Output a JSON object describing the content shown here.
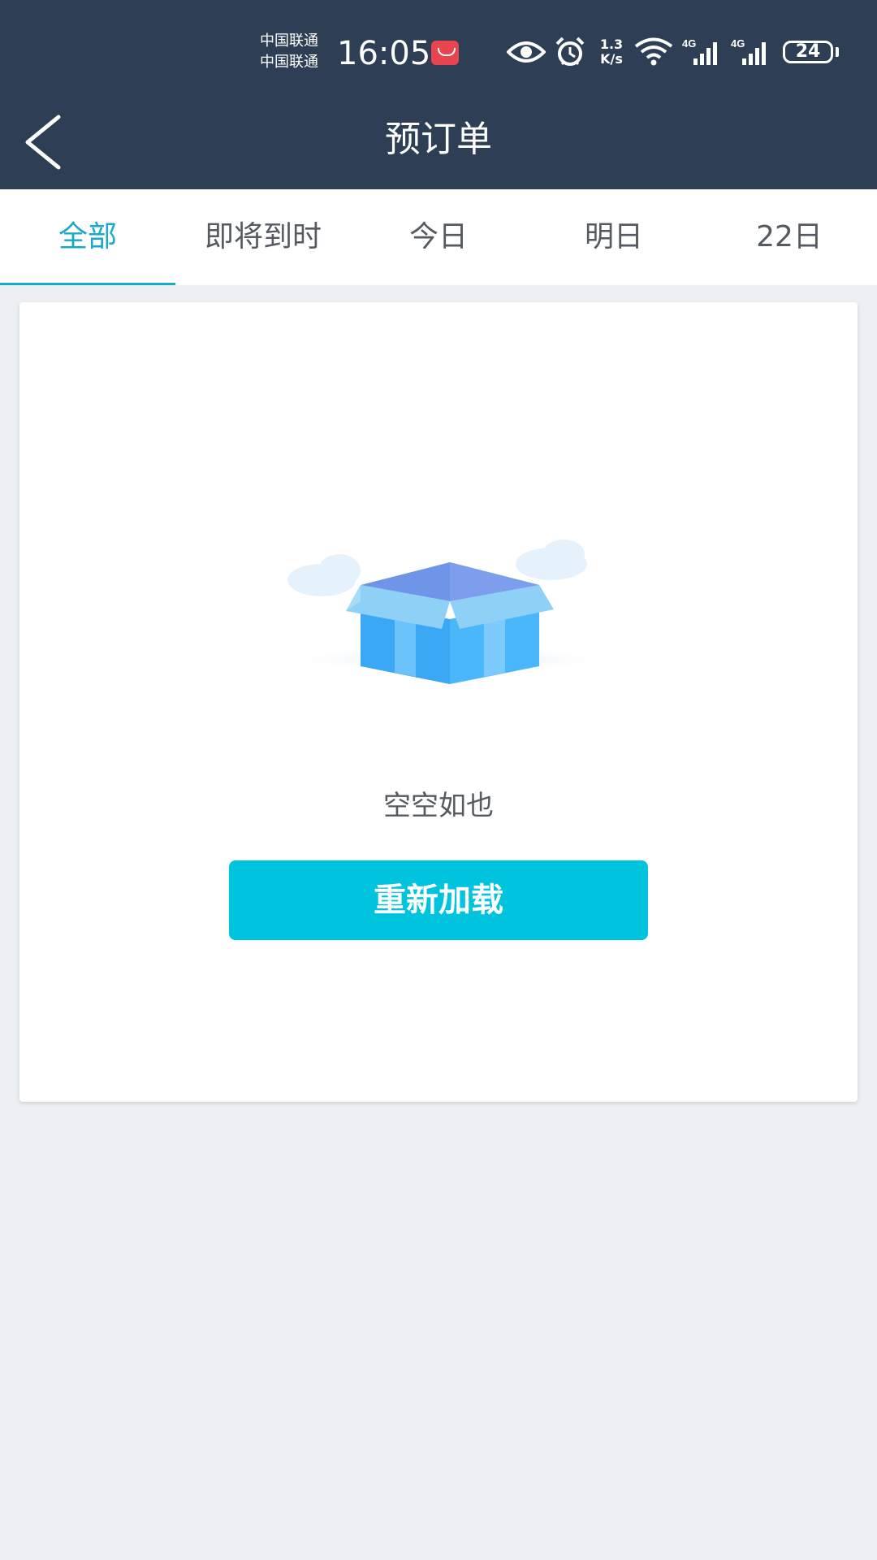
{
  "status_bar": {
    "carrier_1": "中国联通",
    "carrier_2": "中国联通",
    "time": "16:05",
    "network_speed_value": "1.3",
    "network_speed_unit": "K/s",
    "signal_1_label": "4G",
    "signal_2_label": "4G",
    "battery": "24",
    "icons": [
      "huawei-app-icon",
      "eye-icon",
      "alarm-icon",
      "wifi-icon",
      "signal-icon",
      "signal-icon",
      "battery-icon"
    ]
  },
  "header": {
    "title": "预订单",
    "back_icon": "chevron-left-icon"
  },
  "tabs": [
    {
      "label": "全部",
      "active": true
    },
    {
      "label": "即将到时",
      "active": false
    },
    {
      "label": "今日",
      "active": false
    },
    {
      "label": "明日",
      "active": false
    },
    {
      "label": "22日",
      "active": false
    }
  ],
  "empty_state": {
    "illustration": "open-box-icon",
    "message": "空空如也",
    "reload_label": "重新加载"
  },
  "colors": {
    "header_bg": "#2d3e55",
    "accent": "#1aa9c9",
    "button_bg": "#00c3dd",
    "page_bg": "#edf0f3"
  }
}
